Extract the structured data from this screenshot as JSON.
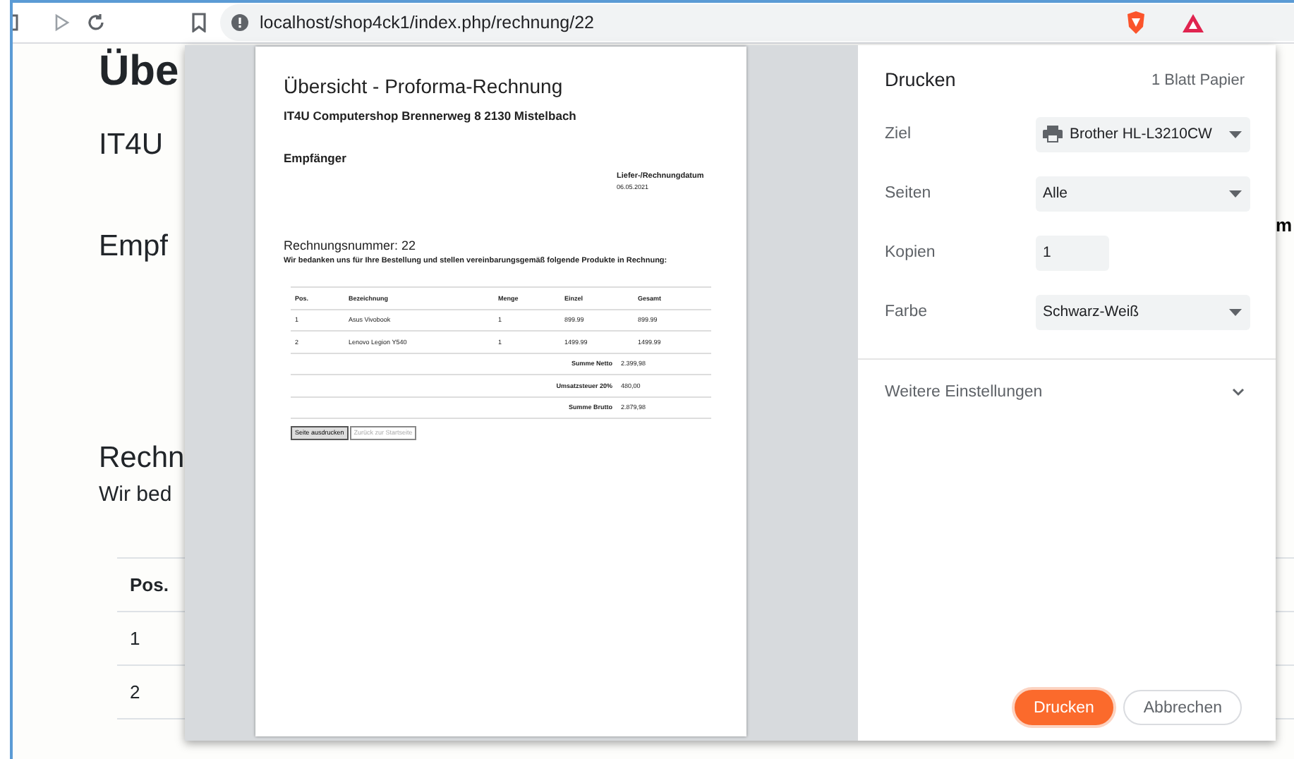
{
  "browser": {
    "url": "localhost/shop4ck1/index.php/rechnung/22"
  },
  "page": {
    "heading": "Übe",
    "company": "IT4U",
    "recipient": "Empf",
    "invoice_heading": "Rechn",
    "intro": "Wir bed",
    "table": {
      "columns": [
        "Pos."
      ],
      "rows": [
        "1",
        "2"
      ]
    },
    "right_fragment": "m"
  },
  "print_dialog": {
    "preview": {
      "title": "Übersicht - Proforma-Rechnung",
      "company": "IT4U Computershop Brennerweg 8 2130 Mistelbach",
      "recipient": "Empfänger",
      "date_label": "Liefer-/Rechnungdatum",
      "date": "06.05.2021",
      "invoice_number": "Rechnungsnummer: 22",
      "intro": "Wir bedanken uns für Ihre Bestellung und stellen vereinbarungsgemäß folgende Produkte in Rechnung:",
      "columns": [
        "Pos.",
        "Bezeichnung",
        "Menge",
        "Einzel",
        "Gesamt"
      ],
      "rows": [
        [
          "1",
          "Asus Vivobook",
          "1",
          "899.99",
          "899.99"
        ],
        [
          "2",
          "Lenovo Legion Y540",
          "1",
          "1499.99",
          "1499.99"
        ]
      ],
      "totals": [
        {
          "label": "Summe Netto",
          "value": "2.399,98"
        },
        {
          "label": "Umsatzsteuer 20%",
          "value": "480,00"
        },
        {
          "label": "Summe Brutto",
          "value": "2.879,98"
        }
      ],
      "buttons": [
        {
          "label": "Seite ausdrucken",
          "enabled": true
        },
        {
          "label": "Zurück zur Startseite",
          "enabled": false
        }
      ]
    },
    "settings": {
      "title": "Drucken",
      "sheets": "1 Blatt Papier",
      "fields": [
        {
          "label": "Ziel",
          "kind": "device",
          "value": "Brother HL-L3210CW"
        },
        {
          "label": "Seiten",
          "kind": "select",
          "value": "Alle"
        },
        {
          "label": "Kopien",
          "kind": "number",
          "value": "1"
        },
        {
          "label": "Farbe",
          "kind": "select",
          "value": "Schwarz-Weiß"
        }
      ],
      "more": {
        "label": "Weitere Einstellungen",
        "expanded": false
      },
      "buttons": [
        {
          "label": "Drucken",
          "primary": true
        },
        {
          "label": "Abbrechen",
          "primary": false
        }
      ]
    }
  }
}
